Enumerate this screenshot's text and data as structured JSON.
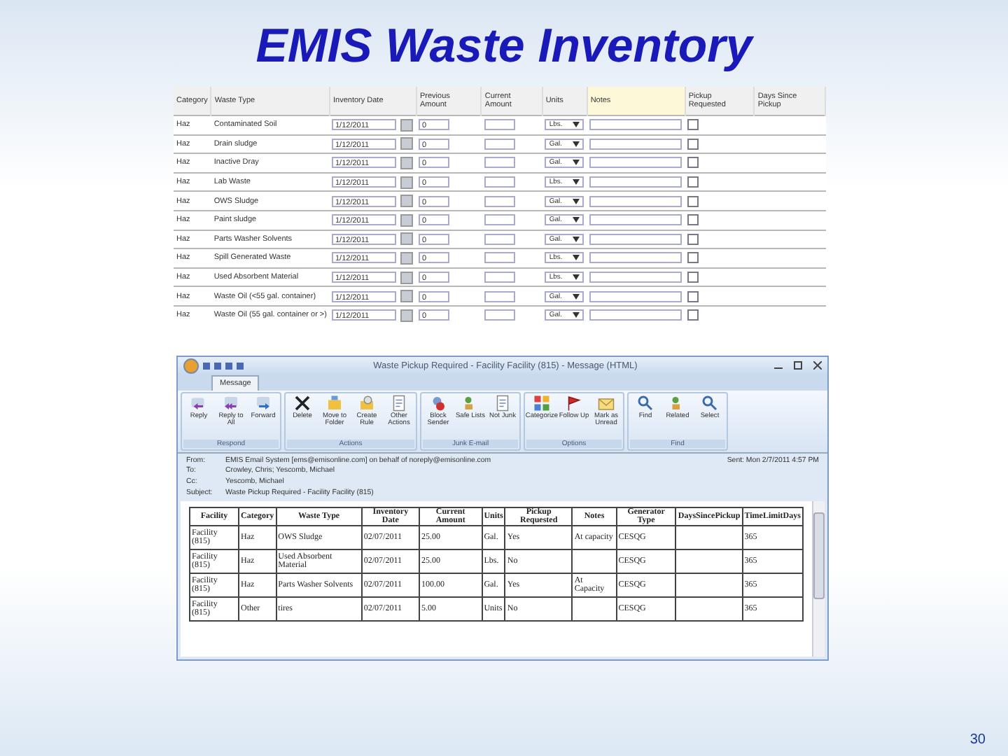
{
  "slide": {
    "title": "EMIS Waste Inventory",
    "page_number": "30"
  },
  "inventory": {
    "columns": [
      "Category",
      "Waste Type",
      "Inventory Date",
      "Previous Amount",
      "Current Amount",
      "Units",
      "Notes",
      "Pickup Requested",
      "Days Since Pickup"
    ],
    "rows": [
      {
        "category": "Haz",
        "waste_type": "Contaminated Soil",
        "date": "1/12/2011",
        "previous": "0",
        "units": "Lbs.",
        "pickup": false
      },
      {
        "category": "Haz",
        "waste_type": "Drain sludge",
        "date": "1/12/2011",
        "previous": "0",
        "units": "Gal.",
        "pickup": false
      },
      {
        "category": "Haz",
        "waste_type": "Inactive Dray",
        "date": "1/12/2011",
        "previous": "0",
        "units": "Gal.",
        "pickup": false
      },
      {
        "category": "Haz",
        "waste_type": "Lab Waste",
        "date": "1/12/2011",
        "previous": "0",
        "units": "Lbs.",
        "pickup": false
      },
      {
        "category": "Haz",
        "waste_type": "OWS Sludge",
        "date": "1/12/2011",
        "previous": "0",
        "units": "Gal.",
        "pickup": false
      },
      {
        "category": "Haz",
        "waste_type": "Paint sludge",
        "date": "1/12/2011",
        "previous": "0",
        "units": "Gal.",
        "pickup": false
      },
      {
        "category": "Haz",
        "waste_type": "Parts Washer Solvents",
        "date": "1/12/2011",
        "previous": "0",
        "units": "Gal.",
        "pickup": false
      },
      {
        "category": "Haz",
        "waste_type": "Spill Generated Waste",
        "date": "1/12/2011",
        "previous": "0",
        "units": "Lbs.",
        "pickup": false
      },
      {
        "category": "Haz",
        "waste_type": "Used Absorbent Material",
        "date": "1/12/2011",
        "previous": "0",
        "units": "Lbs.",
        "pickup": false
      },
      {
        "category": "Haz",
        "waste_type": "Waste Oil (<55 gal. container)",
        "date": "1/12/2011",
        "previous": "0",
        "units": "Gal.",
        "pickup": false
      },
      {
        "category": "Haz",
        "waste_type": "Waste Oil (55 gal. container or >)",
        "date": "1/12/2011",
        "previous": "0",
        "units": "Gal.",
        "pickup": false
      }
    ]
  },
  "email": {
    "window_title": "Waste Pickup Required - Facility Facility (815) - Message (HTML)",
    "tabs": [
      {
        "label": "Message",
        "selected": true
      }
    ],
    "ribbon_groups": [
      {
        "name": "Respond",
        "buttons": [
          {
            "label": "Reply"
          },
          {
            "label": "Reply to All"
          },
          {
            "label": "Forward"
          }
        ]
      },
      {
        "name": "Actions",
        "buttons": [
          {
            "label": "Delete"
          },
          {
            "label": "Move to Folder"
          },
          {
            "label": "Create Rule"
          },
          {
            "label": "Other Actions"
          }
        ]
      },
      {
        "name": "Junk E-mail",
        "buttons": [
          {
            "label": "Block Sender"
          },
          {
            "label": "Safe Lists"
          },
          {
            "label": "Not Junk"
          }
        ]
      },
      {
        "name": "Options",
        "buttons": [
          {
            "label": "Categorize"
          },
          {
            "label": "Follow Up"
          },
          {
            "label": "Mark as Unread"
          }
        ]
      },
      {
        "name": "Find",
        "buttons": [
          {
            "label": "Find"
          },
          {
            "label": "Related"
          },
          {
            "label": "Select"
          }
        ]
      }
    ],
    "headers": [
      {
        "label": "From:",
        "value": "EMIS Email System [ems@emisonline.com] on behalf of noreply@emisonline.com"
      },
      {
        "label": "To:",
        "value": "Crowley, Chris; Yescomb, Michael"
      },
      {
        "label": "Cc:",
        "value": "Yescomb, Michael"
      },
      {
        "label": "Subject:",
        "value": "Waste Pickup Required - Facility Facility (815)"
      }
    ],
    "sent": "Sent: Mon 2/7/2011 4:57 PM",
    "table": {
      "columns": [
        "Facility",
        "Category",
        "Waste Type",
        "Inventory Date",
        "Current Amount",
        "Units",
        "Pickup Requested",
        "Notes",
        "Generator Type",
        "DaysSincePickup",
        "TimeLimitDays"
      ],
      "rows": [
        {
          "facility": "Facility (815)",
          "category": "Haz",
          "waste_type": "OWS Sludge",
          "date": "02/07/2011",
          "amount": "25.00",
          "units": "Gal.",
          "pickup": "Yes",
          "notes": "At capacity",
          "generator": "CESQG",
          "limit": "365"
        },
        {
          "facility": "Facility (815)",
          "category": "Haz",
          "waste_type": "Used Absorbent Material",
          "date": "02/07/2011",
          "amount": "25.00",
          "units": "Lbs.",
          "pickup": "No",
          "generator": "CESQG",
          "limit": "365"
        },
        {
          "facility": "Facility (815)",
          "category": "Haz",
          "waste_type": "Parts Washer Solvents",
          "date": "02/07/2011",
          "amount": "100.00",
          "units": "Gal.",
          "pickup": "Yes",
          "notes": "At Capacity",
          "generator": "CESQG",
          "limit": "365"
        },
        {
          "facility": "Facility (815)",
          "category": "Other",
          "waste_type": "tires",
          "date": "02/07/2011",
          "amount": "5.00",
          "units": "Units",
          "pickup": "No",
          "generator": "CESQG",
          "limit": "365"
        }
      ]
    }
  }
}
